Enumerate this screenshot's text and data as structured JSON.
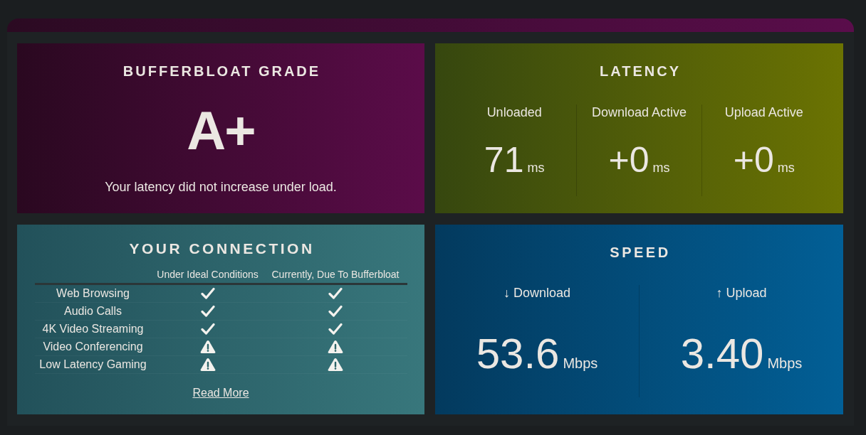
{
  "grade": {
    "title": "BUFFERBLOAT GRADE",
    "grade": "A+",
    "message": "Your latency did not increase under load."
  },
  "latency": {
    "title": "LATENCY",
    "columns": [
      {
        "label": "Unloaded",
        "value": "71",
        "unit": "ms"
      },
      {
        "label": "Download Active",
        "value": "+0",
        "unit": "ms"
      },
      {
        "label": "Upload Active",
        "value": "+0",
        "unit": "ms"
      }
    ]
  },
  "connection": {
    "title": "YOUR CONNECTION",
    "headers": [
      "Under Ideal Conditions",
      "Currently, Due To Bufferbloat"
    ],
    "rows": [
      {
        "activity": "Web Browsing",
        "ideal_ok": true,
        "current_ok": true
      },
      {
        "activity": "Audio Calls",
        "ideal_ok": true,
        "current_ok": true
      },
      {
        "activity": "4K Video Streaming",
        "ideal_ok": true,
        "current_ok": true
      },
      {
        "activity": "Video Conferencing",
        "ideal_ok": false,
        "current_ok": false
      },
      {
        "activity": "Low Latency Gaming",
        "ideal_ok": false,
        "current_ok": false
      }
    ],
    "link": "Read More"
  },
  "speed": {
    "title": "SPEED",
    "columns": [
      {
        "label": "↓ Download",
        "value": "53.6",
        "unit": "Mbps"
      },
      {
        "label": "↑ Upload",
        "value": "3.40",
        "unit": "Mbps"
      }
    ]
  }
}
